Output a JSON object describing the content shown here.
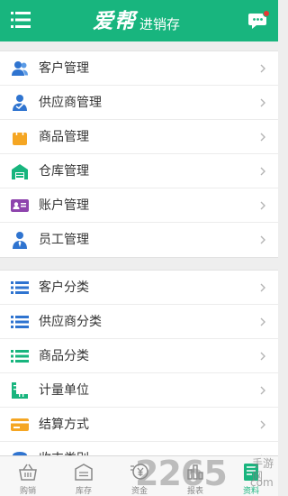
{
  "header": {
    "brand_main": "爱帮",
    "brand_sub": "进销存",
    "accent": "#18b57e"
  },
  "groups": [
    {
      "items": [
        {
          "label": "客户管理",
          "icon": "customers-icon",
          "color": "#2f74d0"
        },
        {
          "label": "供应商管理",
          "icon": "supplier-icon",
          "color": "#2f74d0"
        },
        {
          "label": "商品管理",
          "icon": "shopping-bag-icon",
          "color": "#f5a623"
        },
        {
          "label": "仓库管理",
          "icon": "warehouse-icon",
          "color": "#18b57e"
        },
        {
          "label": "账户管理",
          "icon": "account-card-icon",
          "color": "#8e44ad"
        },
        {
          "label": "员工管理",
          "icon": "employee-icon",
          "color": "#2f74d0"
        }
      ]
    },
    {
      "items": [
        {
          "label": "客户分类",
          "icon": "list-icon",
          "color": "#2f74d0"
        },
        {
          "label": "供应商分类",
          "icon": "list-icon",
          "color": "#2f74d0"
        },
        {
          "label": "商品分类",
          "icon": "list-icon",
          "color": "#18b57e"
        },
        {
          "label": "计量单位",
          "icon": "ruler-icon",
          "color": "#18b57e"
        },
        {
          "label": "结算方式",
          "icon": "card-icon",
          "color": "#f5a623"
        },
        {
          "label": "收支类别",
          "icon": "category-icon",
          "color": "#2f74d0"
        }
      ]
    }
  ],
  "tabbar": {
    "tabs": [
      {
        "label": "购销",
        "icon": "basket-icon",
        "active": false
      },
      {
        "label": "库存",
        "icon": "inventory-icon",
        "active": false
      },
      {
        "label": "资金",
        "icon": "money-icon",
        "active": false
      },
      {
        "label": "报表",
        "icon": "report-icon",
        "active": false
      },
      {
        "label": "资料",
        "icon": "document-icon",
        "active": true
      }
    ]
  },
  "watermark": {
    "number": "2265",
    "suffix": "com",
    "text": "手游网"
  }
}
